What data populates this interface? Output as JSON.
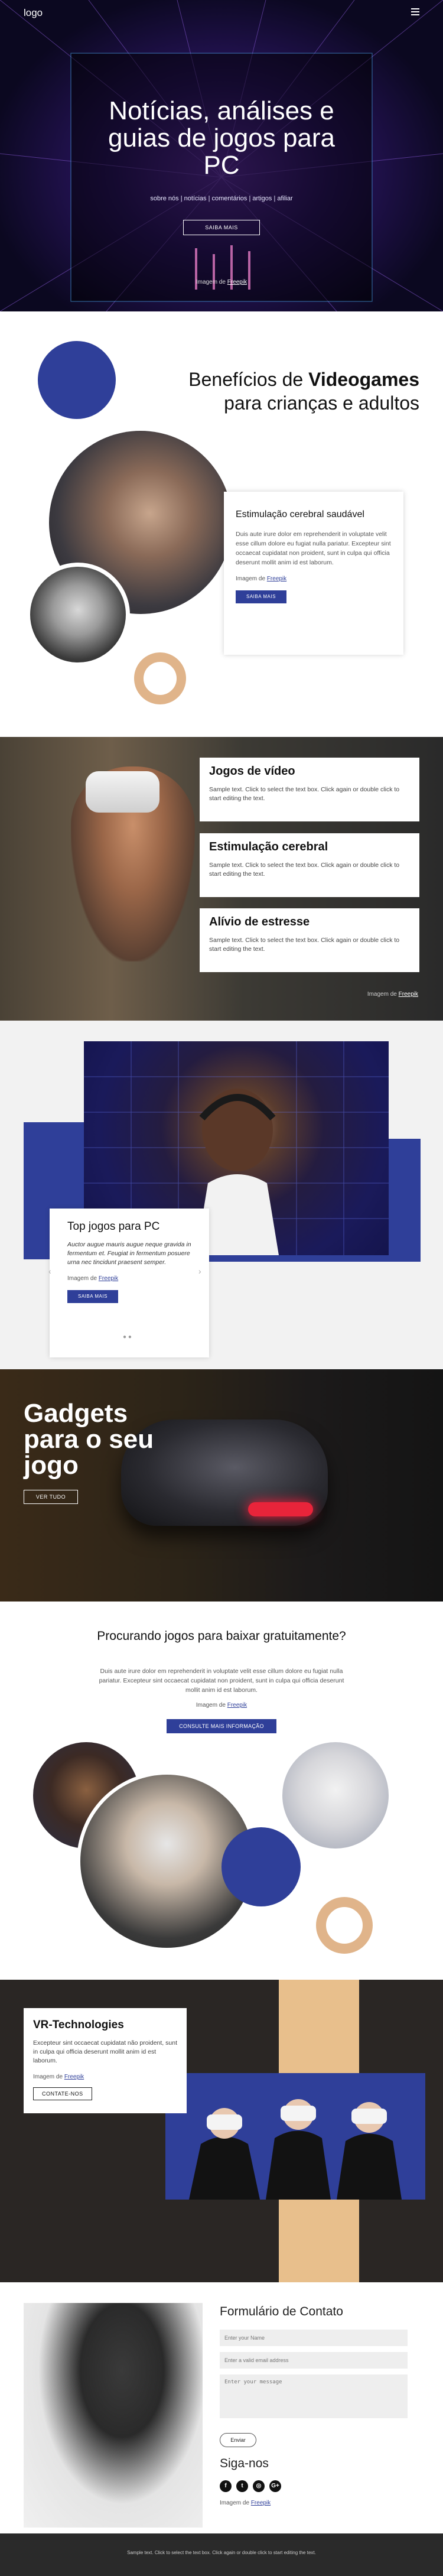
{
  "header": {
    "logo": "logo",
    "menu_icon": "hamburger-menu-icon"
  },
  "hero": {
    "title": "Notícias, análises e guias de jogos para PC",
    "tags": "sobre nós | notícias | comentários | artigos | afiliar",
    "button": "SAIBA MAIS",
    "credit_prefix": "Imagem de ",
    "credit_link": "Freepik"
  },
  "benefits": {
    "title_pre": "Benefícios de ",
    "title_bold": "Videogames",
    "title_post": "para crianças e adultos",
    "card_title": "Estimulação cerebral saudável",
    "card_text": "Duis aute irure dolor em reprehenderit in voluptate velit esse cillum dolore eu fugiat nulla pariatur. Excepteur sint occaecat cupidatat non proident, sunt in culpa qui officia deserunt mollit anim id est laborum.",
    "credit_prefix": "Imagem de ",
    "credit_link": "Freepik",
    "button": "SAIBA MAIS"
  },
  "vr": {
    "cards": [
      {
        "title": "Jogos de vídeo",
        "text": "Sample text. Click to select the text box. Click again or double click to start editing the text."
      },
      {
        "title": "Estimulação cerebral",
        "text": "Sample text. Click to select the text box. Click again or double click to start editing the text."
      },
      {
        "title": "Alívio de estresse",
        "text": "Sample text. Click to select the text box. Click again or double click to start editing the text."
      }
    ],
    "credit_prefix": "Imagem de ",
    "credit_link": "Freepik"
  },
  "top": {
    "title": "Top jogos para PC",
    "text": "Auctor augue mauris augue neque gravida in fermentum et. Feugiat in fermentum posuere urna nec tincidunt praesent semper.",
    "credit_prefix": "Imagem de ",
    "credit_link": "Freepik",
    "button": "SAIBA MAIS",
    "prev": "‹",
    "next": "›",
    "dots": "● ●"
  },
  "gadgets": {
    "title": "Gadgets para o seu jogo",
    "button": "VER TUDO"
  },
  "procurando": {
    "title": "Procurando jogos para baixar gratuitamente?",
    "text": "Duis aute irure dolor em reprehenderit in voluptate velit esse cillum dolore eu fugiat nulla pariatur. Excepteur sint occaecat cupidatat non proident, sunt in culpa qui officia deserunt mollit anim id est laborum.",
    "credit_prefix": "Imagem de ",
    "credit_link": "Freepik",
    "button": "CONSULTE MAIS INFORMAÇÃO"
  },
  "vrtech": {
    "title": "VR-Technologies",
    "text": "Excepteur sint occaecat cupidatat não proident, sunt in culpa qui officia deserunt mollit anim id est laborum.",
    "credit_prefix": "Imagem de ",
    "credit_link": "Freepik",
    "button": "CONTATE-NOS"
  },
  "contact": {
    "title": "Formulário de Contato",
    "name_placeholder": "Enter your Name",
    "email_placeholder": "Enter a valid email address",
    "message_placeholder": "Enter your message",
    "submit": "Enviar",
    "follow": "Siga-nos",
    "social": [
      "f",
      "t",
      "◎",
      "G+"
    ],
    "credit_prefix": "Imagem de ",
    "credit_link": "Freepik"
  },
  "footer": {
    "text": "Sample text. Click to select the text box. Click again or double click to start editing the text."
  },
  "colors": {
    "accent_blue": "#2f3f99",
    "tan": "#e0b48a",
    "dark": "#2a2a2a"
  }
}
